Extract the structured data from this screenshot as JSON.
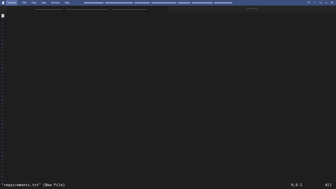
{
  "menubar": {
    "items": [
      {
        "label": "Terminal",
        "active": true
      },
      {
        "label": "Edit",
        "active": false
      },
      {
        "label": "View",
        "active": false
      },
      {
        "label": "Tabs",
        "active": false
      },
      {
        "label": "Window",
        "active": false
      },
      {
        "label": "Help",
        "active": false
      }
    ],
    "right_icons": [
      "edit-icon",
      "wifi-icon",
      "battery-icon",
      "search-icon",
      "control-center-icon"
    ]
  },
  "editor": {
    "empty_line_marker": "~",
    "empty_line_count": 48
  },
  "statusline": {
    "file_message": "\"requirements.txt\" [New File]",
    "cursor_position": "0,0-1",
    "scroll_position": "All"
  },
  "colors": {
    "background": "#1e1e1e",
    "menubar": "#3c4f7e",
    "tilde": "#5a6cff",
    "text": "#e6e6e6"
  }
}
